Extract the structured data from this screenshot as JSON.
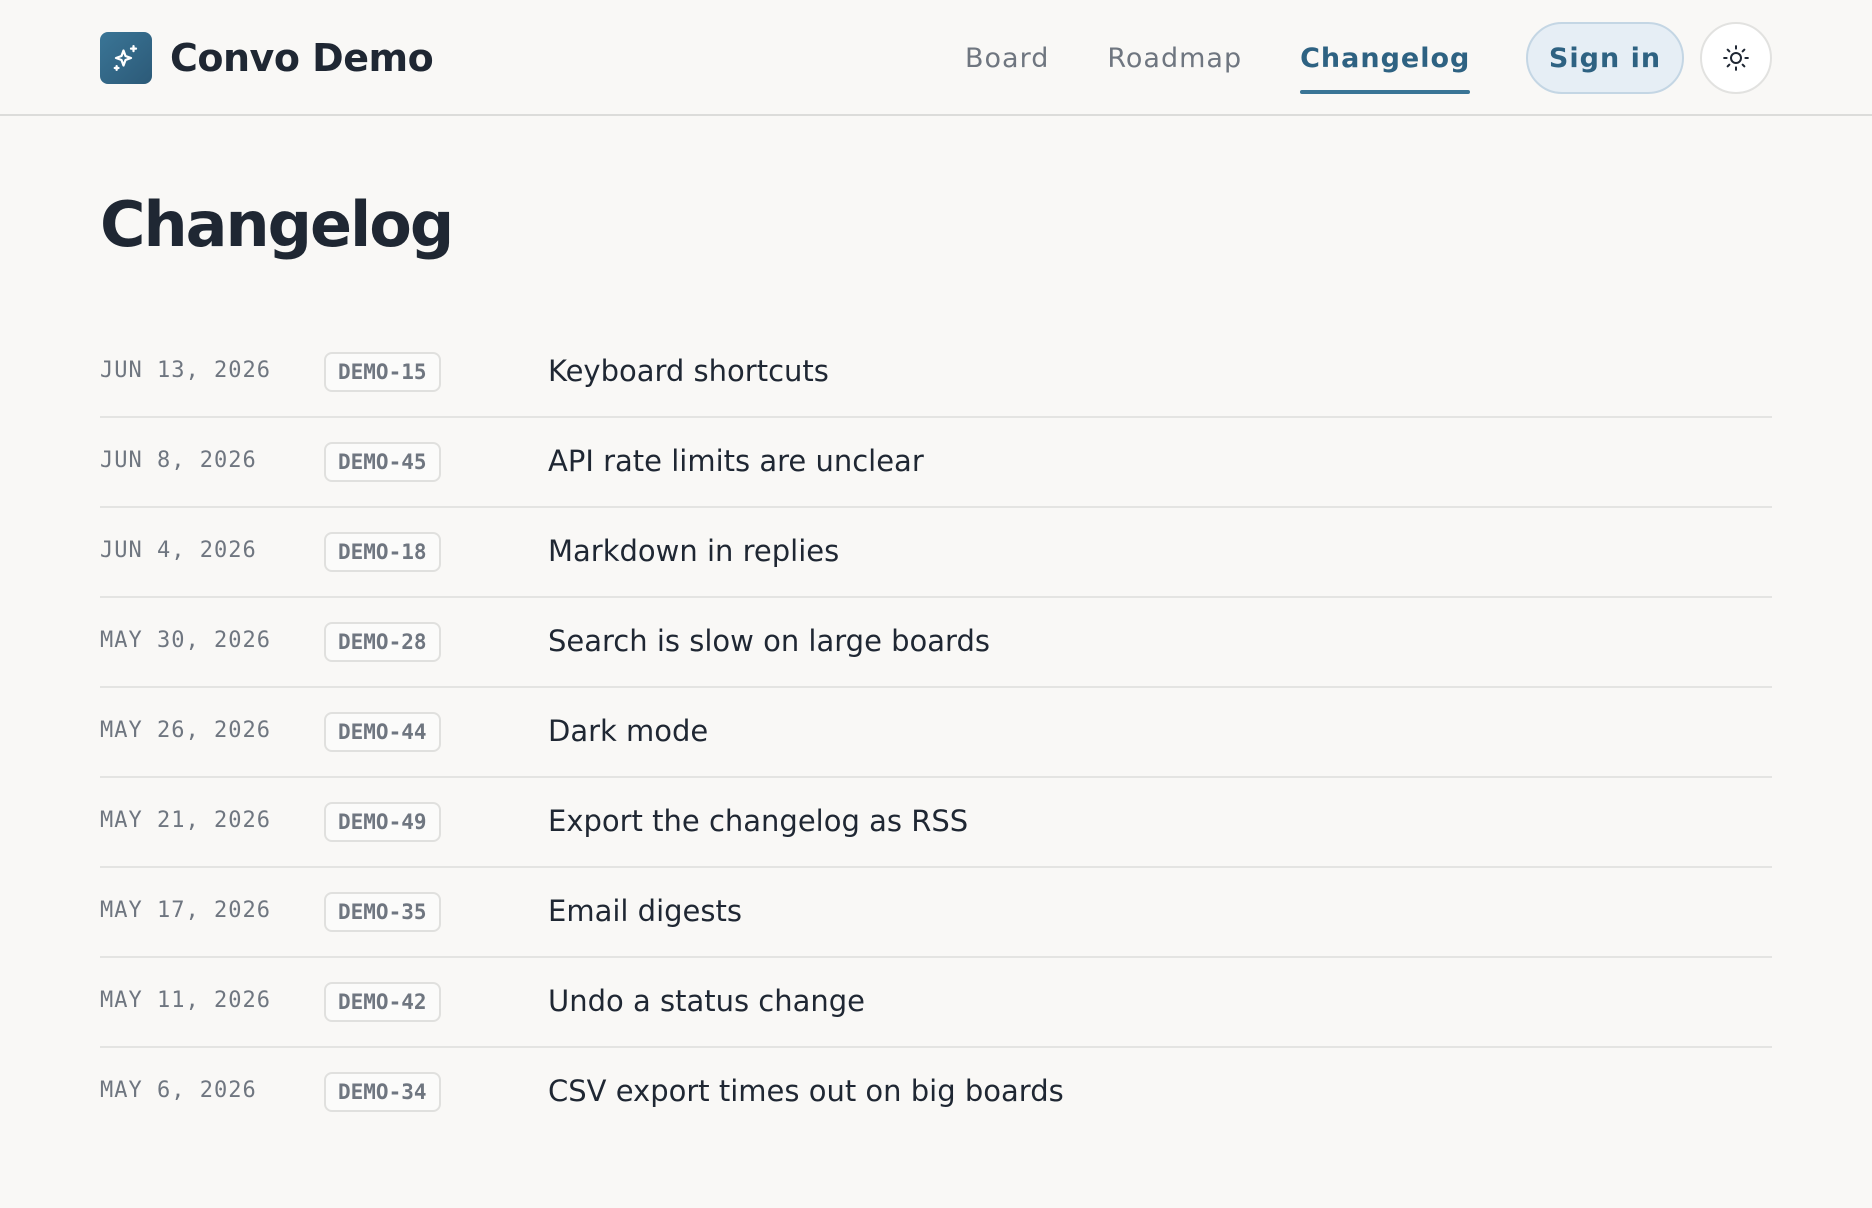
{
  "brand": {
    "name": "Convo Demo",
    "logo_icon": "sparkles-icon"
  },
  "nav": {
    "items": [
      {
        "label": "Board",
        "active": false
      },
      {
        "label": "Roadmap",
        "active": false
      },
      {
        "label": "Changelog",
        "active": true
      }
    ]
  },
  "header": {
    "signin_label": "Sign in",
    "theme_icon": "sun-icon"
  },
  "page": {
    "title": "Changelog"
  },
  "changelog": [
    {
      "date": "JUN 13, 2026",
      "id": "DEMO-15",
      "title": "Keyboard shortcuts"
    },
    {
      "date": "JUN 8, 2026",
      "id": "DEMO-45",
      "title": "API rate limits are unclear"
    },
    {
      "date": "JUN 4, 2026",
      "id": "DEMO-18",
      "title": "Markdown in replies"
    },
    {
      "date": "MAY 30, 2026",
      "id": "DEMO-28",
      "title": "Search is slow on large boards"
    },
    {
      "date": "MAY 26, 2026",
      "id": "DEMO-44",
      "title": "Dark mode"
    },
    {
      "date": "MAY 21, 2026",
      "id": "DEMO-49",
      "title": "Export the changelog as RSS"
    },
    {
      "date": "MAY 17, 2026",
      "id": "DEMO-35",
      "title": "Email digests"
    },
    {
      "date": "MAY 11, 2026",
      "id": "DEMO-42",
      "title": "Undo a status change"
    },
    {
      "date": "MAY 6, 2026",
      "id": "DEMO-34",
      "title": "CSV export times out on big boards"
    }
  ],
  "colors": {
    "accent": "#2e6282",
    "background": "#f9f8f6",
    "text": "#1f2733",
    "muted": "#6f7680"
  }
}
